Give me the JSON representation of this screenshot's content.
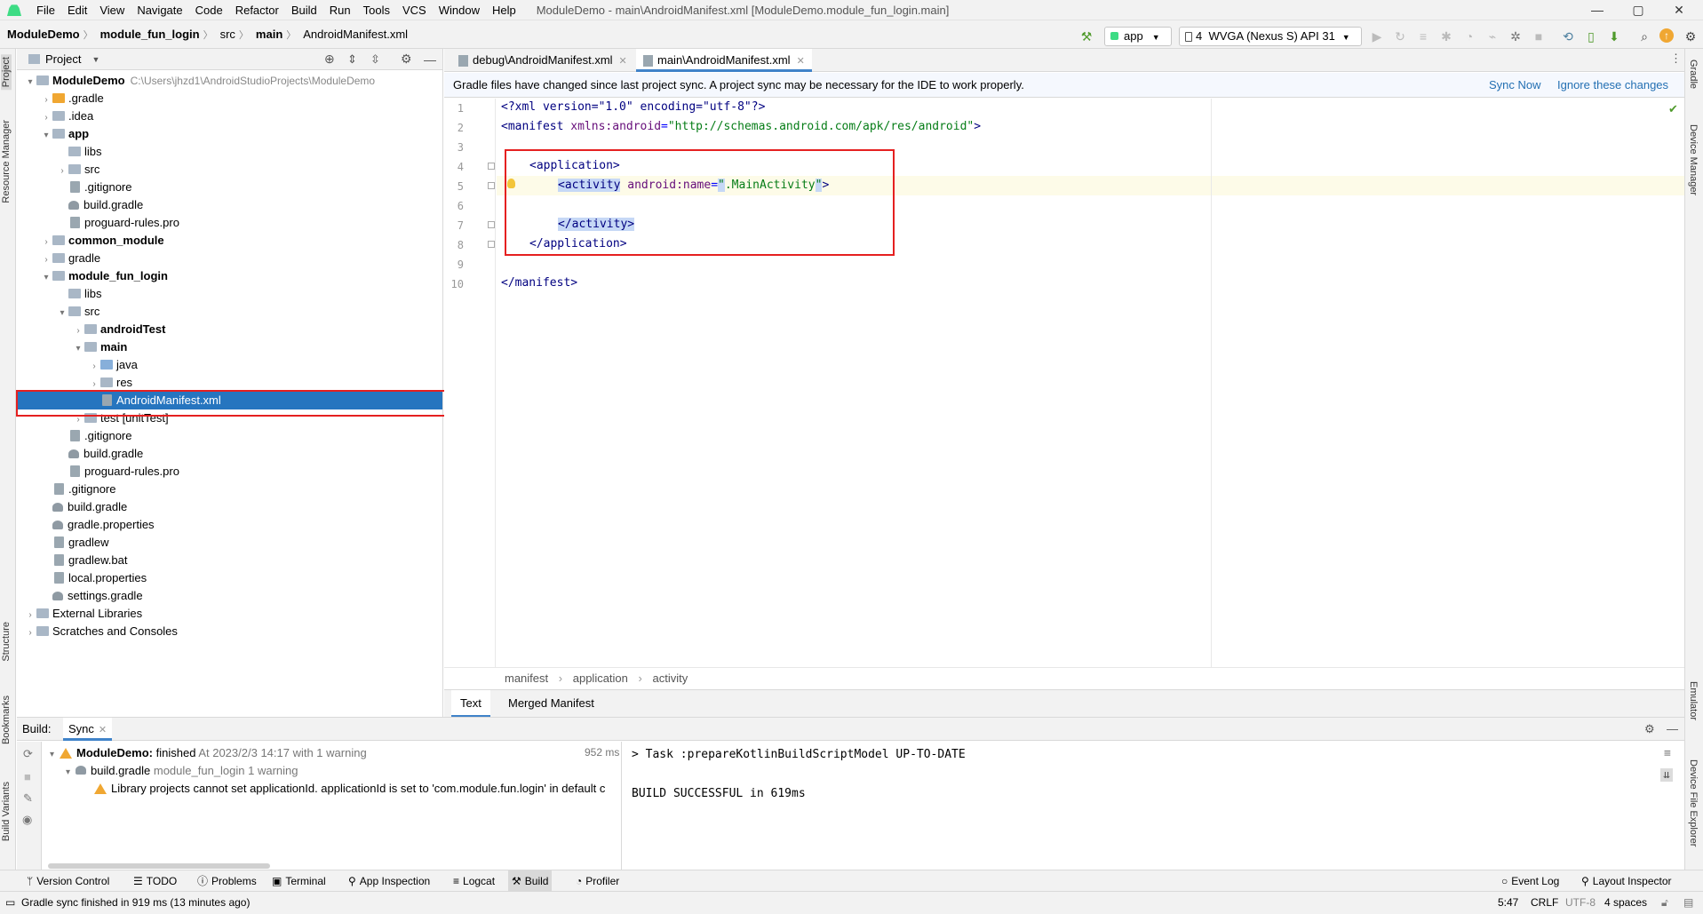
{
  "window": {
    "title": "ModuleDemo - main\\AndroidManifest.xml [ModuleDemo.module_fun_login.main]",
    "controls": [
      "—",
      "▢",
      "✕"
    ]
  },
  "menu": [
    "File",
    "Edit",
    "View",
    "Navigate",
    "Code",
    "Refactor",
    "Build",
    "Run",
    "Tools",
    "VCS",
    "Window",
    "Help"
  ],
  "breadcrumb": [
    "ModuleDemo",
    "module_fun_login",
    "src",
    "main",
    "AndroidManifest.xml"
  ],
  "toolbar": {
    "run_config": "app",
    "device_count": "4",
    "device": "WVGA (Nexus S) API 31"
  },
  "left_strip": [
    "Project",
    "Resource Manager",
    "Structure",
    "Bookmarks",
    "Build Variants"
  ],
  "right_strip": [
    "Gradle",
    "Device Manager",
    "Emulator",
    "Device File Explorer"
  ],
  "project_panel": {
    "title": "Project",
    "root_path": "C:\\Users\\jhzd1\\AndroidStudioProjects\\ModuleDemo",
    "tree": [
      {
        "label": "ModuleDemo",
        "depth": 0,
        "arrow": "▾",
        "icon": "folder",
        "bold": true
      },
      {
        "label": ".gradle",
        "depth": 1,
        "arrow": "›",
        "icon": "folder-orange"
      },
      {
        "label": ".idea",
        "depth": 1,
        "arrow": "›",
        "icon": "folder"
      },
      {
        "label": "app",
        "depth": 1,
        "arrow": "▾",
        "icon": "folder",
        "bold": true
      },
      {
        "label": "libs",
        "depth": 2,
        "arrow": "",
        "icon": "folder"
      },
      {
        "label": "src",
        "depth": 2,
        "arrow": "›",
        "icon": "folder"
      },
      {
        "label": ".gitignore",
        "depth": 2,
        "arrow": "",
        "icon": "file"
      },
      {
        "label": "build.gradle",
        "depth": 2,
        "arrow": "",
        "icon": "gradle"
      },
      {
        "label": "proguard-rules.pro",
        "depth": 2,
        "arrow": "",
        "icon": "file"
      },
      {
        "label": "common_module",
        "depth": 1,
        "arrow": "›",
        "icon": "folder",
        "bold": true
      },
      {
        "label": "gradle",
        "depth": 1,
        "arrow": "›",
        "icon": "folder"
      },
      {
        "label": "module_fun_login",
        "depth": 1,
        "arrow": "▾",
        "icon": "folder",
        "bold": true
      },
      {
        "label": "libs",
        "depth": 2,
        "arrow": "",
        "icon": "folder"
      },
      {
        "label": "src",
        "depth": 2,
        "arrow": "▾",
        "icon": "folder"
      },
      {
        "label": "androidTest",
        "depth": 3,
        "arrow": "›",
        "icon": "folder",
        "bold": true
      },
      {
        "label": "main",
        "depth": 3,
        "arrow": "▾",
        "icon": "folder",
        "bold": true
      },
      {
        "label": "java",
        "depth": 4,
        "arrow": "›",
        "icon": "folder-blue"
      },
      {
        "label": "res",
        "depth": 4,
        "arrow": "›",
        "icon": "folder"
      },
      {
        "label": "AndroidManifest.xml",
        "depth": 4,
        "arrow": "",
        "icon": "file",
        "selected": true
      },
      {
        "label": "test [unitTest]",
        "depth": 3,
        "arrow": "›",
        "icon": "folder"
      },
      {
        "label": ".gitignore",
        "depth": 2,
        "arrow": "",
        "icon": "file"
      },
      {
        "label": "build.gradle",
        "depth": 2,
        "arrow": "",
        "icon": "gradle"
      },
      {
        "label": "proguard-rules.pro",
        "depth": 2,
        "arrow": "",
        "icon": "file"
      },
      {
        "label": ".gitignore",
        "depth": 1,
        "arrow": "",
        "icon": "file"
      },
      {
        "label": "build.gradle",
        "depth": 1,
        "arrow": "",
        "icon": "gradle"
      },
      {
        "label": "gradle.properties",
        "depth": 1,
        "arrow": "",
        "icon": "gradle"
      },
      {
        "label": "gradlew",
        "depth": 1,
        "arrow": "",
        "icon": "file"
      },
      {
        "label": "gradlew.bat",
        "depth": 1,
        "arrow": "",
        "icon": "file"
      },
      {
        "label": "local.properties",
        "depth": 1,
        "arrow": "",
        "icon": "file"
      },
      {
        "label": "settings.gradle",
        "depth": 1,
        "arrow": "",
        "icon": "gradle"
      },
      {
        "label": "External Libraries",
        "depth": 0,
        "arrow": "›",
        "icon": "folder"
      },
      {
        "label": "Scratches and Consoles",
        "depth": 0,
        "arrow": "›",
        "icon": "folder"
      }
    ]
  },
  "editor": {
    "tabs": [
      {
        "label": "debug\\AndroidManifest.xml",
        "active": false
      },
      {
        "label": "main\\AndroidManifest.xml",
        "active": true
      }
    ],
    "banner": {
      "text": "Gradle files have changed since last project sync. A project sync may be necessary for the IDE to work properly.",
      "sync_now": "Sync Now",
      "ignore": "Ignore these changes"
    },
    "line_numbers": [
      "1",
      "2",
      "3",
      "4",
      "5",
      "6",
      "7",
      "8",
      "9",
      "10"
    ],
    "lines": {
      "l1_pi": "<?xml version=\"1.0\" encoding=\"utf-8\"?>",
      "l2_open": "<manifest ",
      "l2_attr": "xmlns:android",
      "l2_eq": "=",
      "l2_val": "\"http://schemas.android.com/apk/res/android\"",
      "l2_close": ">",
      "l4": "<application>",
      "l5_tag": "<activity",
      "l5_attr": "android:name",
      "l5_eq": "=",
      "l5_q1": "\"",
      "l5_val": ".MainActivity",
      "l5_q2": "\"",
      "l5_close": ">",
      "l7": "</activity>",
      "l8": "</application>",
      "l10": "</manifest>"
    },
    "structure_crumbs": [
      "manifest",
      "application",
      "activity"
    ],
    "bottom_tabs": [
      {
        "label": "Text",
        "active": true
      },
      {
        "label": "Merged Manifest",
        "active": false
      }
    ]
  },
  "build": {
    "label": "Build:",
    "tab": "Sync",
    "root": {
      "name": "ModuleDemo:",
      "status": "finished",
      "detail": "At 2023/2/3 14:17 with 1 warning",
      "time": "952 ms"
    },
    "child": {
      "name": "build.gradle",
      "module": "module_fun_login",
      "warnings": "1 warning"
    },
    "warning": "Library projects cannot set applicationId. applicationId is set to 'com.module.fun.login' in default c",
    "output": [
      "> Task :prepareKotlinBuildScriptModel UP-TO-DATE",
      "",
      "BUILD SUCCESSFUL in 619ms"
    ]
  },
  "tool_windows": [
    {
      "label": "Version Control",
      "icon": "branch-icon"
    },
    {
      "label": "TODO",
      "icon": "list-icon"
    },
    {
      "label": "Problems",
      "icon": "problems-icon"
    },
    {
      "label": "Terminal",
      "icon": "terminal-icon"
    },
    {
      "label": "App Inspection",
      "icon": "inspection-icon"
    },
    {
      "label": "Logcat",
      "icon": "logcat-icon"
    },
    {
      "label": "Build",
      "icon": "hammer-icon",
      "active": true
    },
    {
      "label": "Profiler",
      "icon": "profiler-icon"
    }
  ],
  "tool_windows_right": [
    {
      "label": "Event Log",
      "icon": "event-log-icon"
    },
    {
      "label": "Layout Inspector",
      "icon": "layout-inspector-icon"
    }
  ],
  "status": {
    "message": "Gradle sync finished in 919 ms (13 minutes ago)",
    "position": "5:47",
    "line_sep": "CRLF",
    "encoding": "UTF-8",
    "indent": "4 spaces"
  },
  "colors": {
    "accent": "#2675bf",
    "highlight_box": "#e52020",
    "tag": "#000080",
    "string": "#067d17"
  }
}
